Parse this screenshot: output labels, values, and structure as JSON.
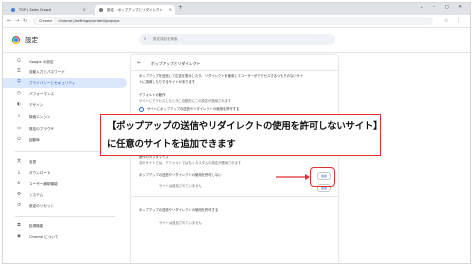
{
  "browser": {
    "tabs": [
      {
        "title": "TOP | Sales Crowd",
        "active": false
      },
      {
        "title": "設定 - ポップアップとリダイレクト",
        "active": true
      }
    ],
    "new_tab": "+",
    "omnibox": {
      "chip": "Chrome",
      "url": "chrome://settings/content/popups"
    }
  },
  "header": {
    "title": "設定",
    "search_placeholder": "設定項目を検索"
  },
  "sidebar": {
    "items": [
      {
        "icon": "G",
        "label": "Google の設定"
      },
      {
        "icon": "⚿",
        "label": "自動入力とパスワード"
      },
      {
        "icon": "⛨",
        "label": "プライバシーとセキュリティ",
        "active": true
      },
      {
        "icon": "◷",
        "label": "パフォーマンス"
      },
      {
        "icon": "◐",
        "label": "デザイン"
      },
      {
        "icon": "⌕",
        "label": "検索エンジン"
      },
      {
        "icon": "▭",
        "label": "既定のブラウザ"
      },
      {
        "icon": "⏻",
        "label": "起動時"
      },
      {
        "icon": "文",
        "label": "言語"
      },
      {
        "icon": "⤓",
        "label": "ダウンロード"
      },
      {
        "icon": "♿",
        "label": "ユーザー補助機能"
      },
      {
        "icon": "⚙",
        "label": "システム"
      },
      {
        "icon": "↺",
        "label": "設定のリセット"
      },
      {
        "icon": "⧉",
        "label": "拡張機能"
      },
      {
        "icon": "◉",
        "label": "Chrome について"
      }
    ]
  },
  "main": {
    "title": "ポップアップとリダイレクト",
    "description_1": "ポップアップを送信して広告を表示したり、リダイレクトを使用してユーザーがアクセスするつもりのないサイ",
    "description_2": "トに誘導したりするサイトがあります",
    "default_heading": "デフォルトの動作",
    "default_sub": "サイトにアクセスしたときに自動的にこの設定が適用されます",
    "option_allow": "サイトにポップアップの送信やリダイレクトの使用を許可する",
    "option_block": "サイトにポップアップの送信やリダイレクトの使用を許可しない",
    "custom_heading": "動作のカスタマイズ",
    "custom_sub": "次のサイトでは、デフォルトではなくカスタムの設定が適用されます",
    "block_list_heading": "ポップアップの送信やリダイレクトの使用を許可しない",
    "block_empty": "サイトは追加されていません",
    "allow_list_heading": "ポップアップの送信やリダイレクトの使用を許可する",
    "allow_empty": "サイトは追加されていません",
    "add_button": "追加"
  },
  "callout": {
    "line1": "【ポップアップの送信やリダイレクトの使用を許可しないサイト】",
    "line2": "に任意のサイトを追加できます"
  },
  "colors": {
    "accent": "#1a73e8",
    "highlight": "#e03030"
  }
}
